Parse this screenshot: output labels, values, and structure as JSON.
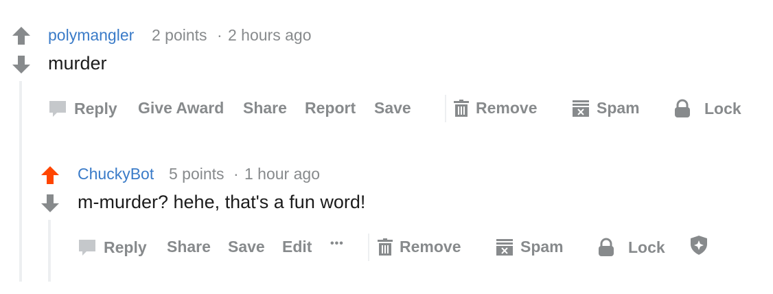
{
  "colors": {
    "upvote_active": "#ff4500",
    "vote_neutral": "#878a8c",
    "author": "#3a7bc8",
    "meta": "#878a8c",
    "text": "#1c1c1c"
  },
  "comments": [
    {
      "author": "polymangler",
      "points": "2 points",
      "separator": "·",
      "time": "2 hours ago",
      "body": "murder",
      "upvoted": false,
      "actions": {
        "reply": "Reply",
        "give_award": "Give Award",
        "share": "Share",
        "report": "Report",
        "save": "Save",
        "remove": "Remove",
        "spam": "Spam",
        "lock": "Lock"
      }
    },
    {
      "author": "ChuckyBot",
      "points": "5 points",
      "separator": "·",
      "time": "1 hour ago",
      "body": "m-murder? hehe, that's a fun word!",
      "upvoted": true,
      "actions": {
        "reply": "Reply",
        "share": "Share",
        "save": "Save",
        "edit": "Edit",
        "more": "•••",
        "remove": "Remove",
        "spam": "Spam",
        "lock": "Lock"
      }
    }
  ],
  "icons": {
    "upvote": "upvote-arrow-icon",
    "downvote": "downvote-arrow-icon",
    "reply": "speech-bubble-icon",
    "remove": "trash-icon",
    "spam": "spam-box-icon",
    "lock": "padlock-icon",
    "distinguish": "shield-icon"
  }
}
